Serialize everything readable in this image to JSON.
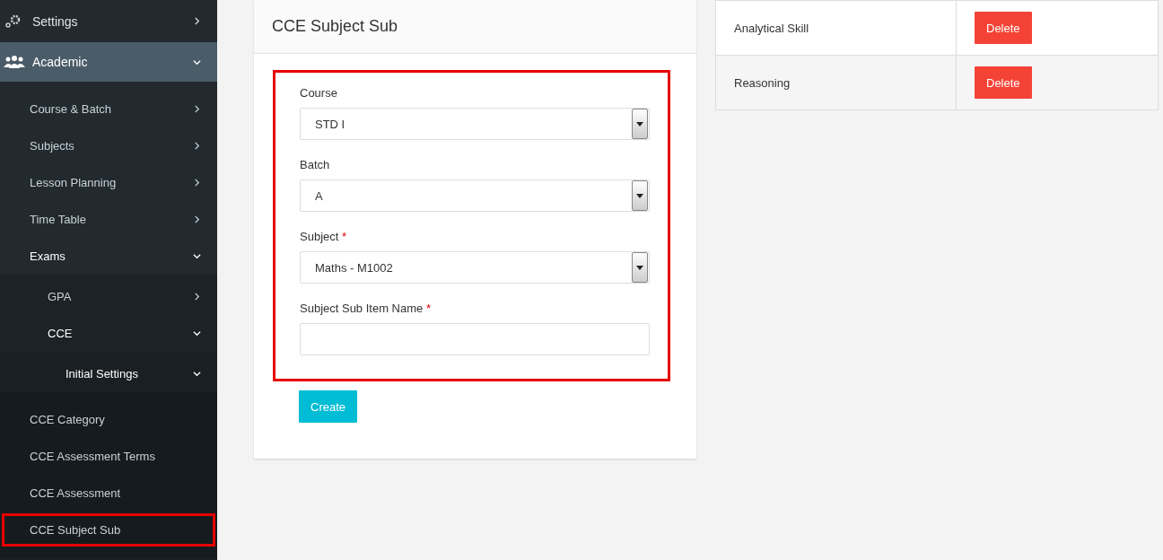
{
  "sidebar": {
    "items": [
      {
        "label": "Settings",
        "expanded": false,
        "highlighted": false
      },
      {
        "label": "Academic",
        "expanded": true,
        "highlighted": false,
        "children": [
          {
            "label": "Course & Batch",
            "expanded": false,
            "highlighted": false
          },
          {
            "label": "Subjects",
            "expanded": false,
            "highlighted": false
          },
          {
            "label": "Lesson Planning",
            "expanded": false,
            "highlighted": false
          },
          {
            "label": "Time Table",
            "expanded": false,
            "highlighted": false
          },
          {
            "label": "Exams",
            "expanded": true,
            "highlighted": false,
            "children": [
              {
                "label": "GPA",
                "expanded": false,
                "highlighted": false
              },
              {
                "label": "CCE",
                "expanded": true,
                "highlighted": false,
                "children": [
                  {
                    "label": "Initial Settings",
                    "expanded": true,
                    "highlighted": false,
                    "children": [
                      {
                        "label": "CCE Category",
                        "highlighted": false
                      },
                      {
                        "label": "CCE Assessment Terms",
                        "highlighted": false
                      },
                      {
                        "label": "CCE Assessment",
                        "highlighted": false
                      },
                      {
                        "label": "CCE Subject Sub",
                        "highlighted": true
                      }
                    ]
                  }
                ]
              }
            ]
          }
        ]
      }
    ]
  },
  "card": {
    "title": "CCE Subject Sub",
    "form_highlighted": true,
    "fields": [
      {
        "kind": "select",
        "label": "Course",
        "value": "STD I"
      },
      {
        "kind": "select",
        "label": "Batch",
        "value": "A"
      },
      {
        "kind": "select",
        "label": "Subject",
        "required_mark": "*",
        "value": "Maths - M1002"
      },
      {
        "kind": "text",
        "label": "Subject Sub Item Name",
        "required_mark": "*"
      }
    ],
    "submit": "Create"
  },
  "table": {
    "rows": [
      {
        "name": "Analytical Skill",
        "action": "Delete"
      },
      {
        "name": "Reasoning",
        "action": "Delete"
      }
    ]
  }
}
